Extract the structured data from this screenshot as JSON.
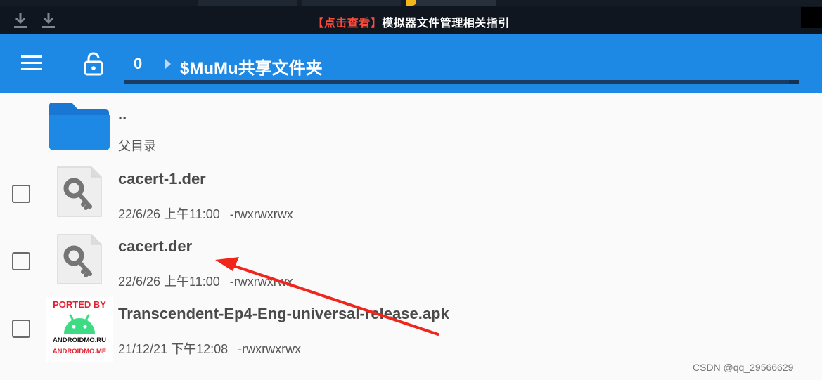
{
  "topbar": {
    "banner_highlight": "【点击查看】",
    "banner_text": "模拟器文件管理相关指引"
  },
  "appbar": {
    "count": "0",
    "path": "$MuMu共享文件夹"
  },
  "files": [
    {
      "name": "..",
      "meta": "父目录",
      "type": "folder"
    },
    {
      "name": "cacert-1.der",
      "date": "22/6/26 上午11:00",
      "perm": "-rwxrwxrwx",
      "type": "key-file",
      "checked": false
    },
    {
      "name": "cacert.der",
      "date": "22/6/26 上午11:00",
      "perm": "-rwxrwxrwx",
      "type": "key-file",
      "checked": false
    },
    {
      "name": "Transcendent-Ep4-Eng-universal-release.apk",
      "date": "21/12/21 下午12:08",
      "perm": "-rwxrwxrwx",
      "type": "apk",
      "checked": false
    }
  ],
  "apk_icon": {
    "line1": "PORTED BY",
    "line2": "ANDROIDMO.RU",
    "line3": "ANDROIDMO.ME"
  },
  "watermark": "CSDN @qq_29566629",
  "colors": {
    "appbar": "#1e88e5",
    "topbar": "#0f1620",
    "folder": "#1976d2",
    "annotation_arrow": "#f0261d"
  }
}
